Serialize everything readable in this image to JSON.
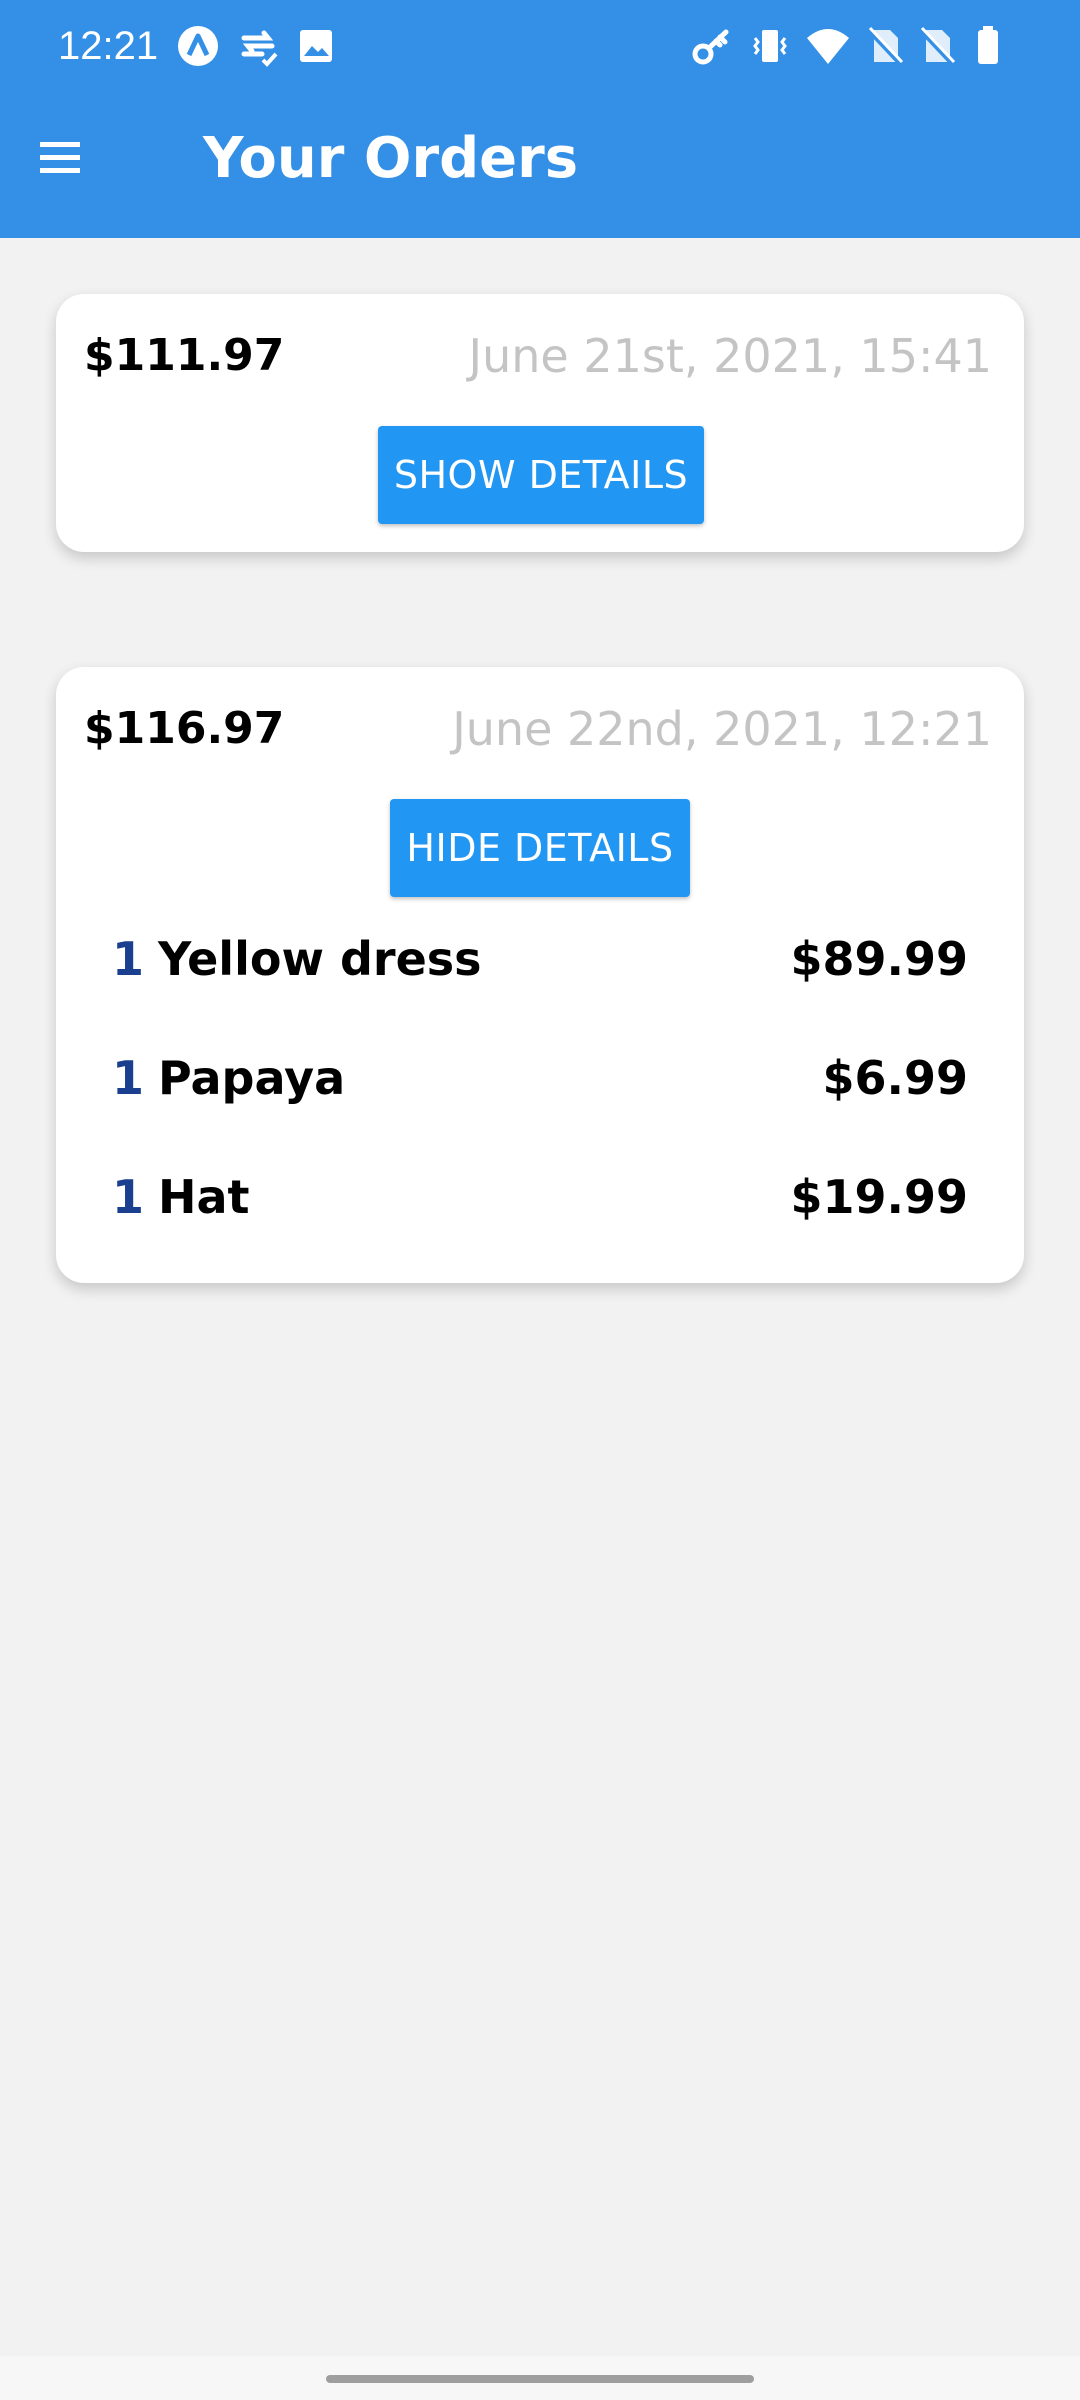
{
  "status_bar": {
    "time": "12:21",
    "left_icons": [
      "a-logo-icon",
      "sync-icon",
      "image-icon"
    ],
    "right_icons": [
      "key-icon",
      "vibrate-icon",
      "wifi-icon",
      "no-sim-icon",
      "no-sim-icon",
      "battery-icon"
    ]
  },
  "toolbar": {
    "title": "Your Orders",
    "menu_icon": "menu-icon"
  },
  "colors": {
    "app_bar": "#3490e6",
    "button": "#2196f3",
    "quantity": "#1a3f8f",
    "date": "#c4c4c4",
    "background": "#f2f2f2"
  },
  "orders": [
    {
      "amount": "$111.97",
      "date": "June 21st, 2021, 15:41",
      "button_label": "SHOW DETAILS",
      "items": []
    },
    {
      "amount": "$116.97",
      "date": "June 22nd, 2021, 12:21",
      "button_label": "HIDE DETAILS",
      "items": [
        {
          "qty": "1",
          "name": "Yellow dress",
          "price": "$89.99"
        },
        {
          "qty": "1",
          "name": "Papaya",
          "price": "$6.99"
        },
        {
          "qty": "1",
          "name": "Hat",
          "price": "$19.99"
        }
      ]
    }
  ]
}
